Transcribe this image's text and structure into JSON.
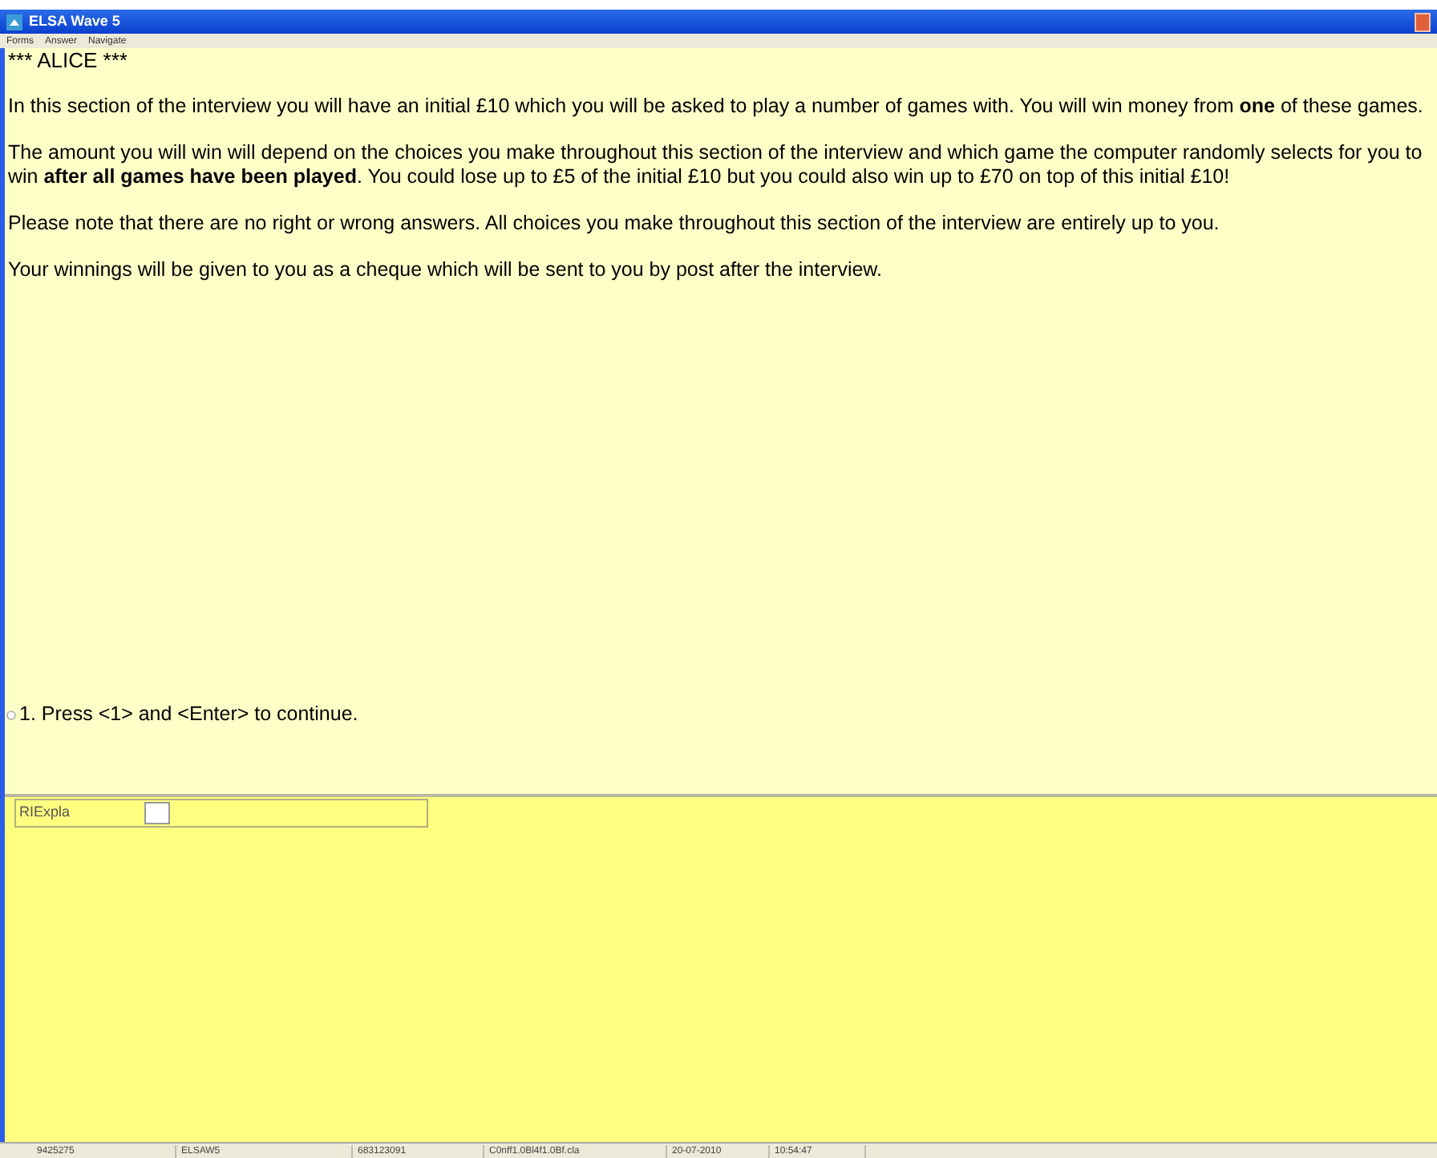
{
  "window": {
    "title": "ELSA Wave 5"
  },
  "menu": [
    "Forms",
    "Answer",
    "Navigate"
  ],
  "question": {
    "heading": "*** ALICE ***",
    "paragraphs": [
      "In this section of the interview you will have an initial £10 which you will be asked to play a number of games with. You will win money from **one** of these games.",
      "The amount you will win will depend on the choices you make throughout this section of the interview and which game the computer randomly selects for you to win **after all games have been played**. You could lose up to £5 of the initial £10 but you could also win up to £70 on top of this initial £10!",
      "Please note that there are no right or wrong answers. All choices you make throughout this section of the interview are entirely up to you.",
      "Your winnings will be given to you as a cheque which will be sent to you by post after the interview."
    ],
    "options": [
      {
        "label": "1. Press <1> and <Enter> to continue.",
        "selected": false
      }
    ]
  },
  "answer_field": {
    "label": "RIExpla"
  },
  "status_bar": [
    "9425275",
    "ELSAW5",
    "683123091",
    "C0nff1.0Bl4f1.0Bf.cla",
    "20-07-2010",
    "10:54:47"
  ]
}
